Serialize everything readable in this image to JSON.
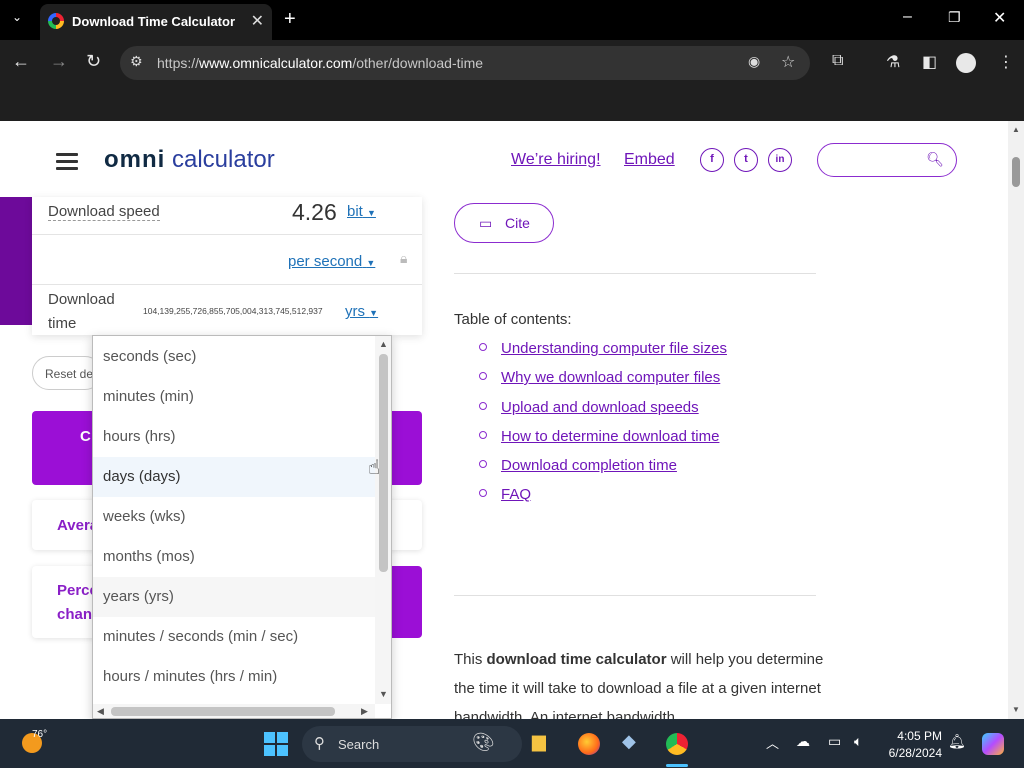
{
  "browser": {
    "tab_title": "Download Time Calculator",
    "url_prefix": "https://",
    "url_domain": "www.omnicalculator.com",
    "url_path": "/other/download-time"
  },
  "header": {
    "logo_omni": "omni",
    "logo_calc": "calculator",
    "hiring": "We’re hiring!",
    "embed": "Embed",
    "social": [
      "f",
      "t",
      "in"
    ]
  },
  "calculator": {
    "download_speed_label": "Download speed",
    "download_speed_value": "4.26",
    "speed_unit": "bit",
    "per_unit": "per second",
    "download_time_label_1": "Download",
    "download_time_label_2": "time",
    "download_time_value": "104,139,255,726,855,705,004,313,745,512,937",
    "time_unit": "yrs",
    "reset": "Reset det",
    "card_avg": "Avera",
    "card_perc_1": "Perce",
    "card_perc_2": "chan",
    "btn_c": "C"
  },
  "dropdown": {
    "options": [
      "seconds (sec)",
      "minutes (min)",
      "hours (hrs)",
      "days (days)",
      "weeks (wks)",
      "months (mos)",
      "years (yrs)",
      "minutes / seconds (min / sec)",
      "hours / minutes (hrs / min)"
    ]
  },
  "content": {
    "cite": "Cite",
    "toc_title": "Table of contents:",
    "toc": [
      "Understanding computer file sizes",
      "Why we download computer files",
      "Upload and download speeds",
      "How to determine download time",
      "Download completion time",
      "FAQ"
    ],
    "para_a": "This ",
    "para_b": "download time calculator",
    "para_c": " will help you determine the time it will take to download a file at a given internet bandwidth. An internet bandwidth"
  },
  "taskbar": {
    "weather": "76°",
    "search": "Search",
    "time": "4:05 PM",
    "date": "6/28/2024"
  },
  "colors": {
    "accent": "#6f15b9",
    "button_purple": "#9b0fd6",
    "link_blue": "#1f72b8"
  }
}
